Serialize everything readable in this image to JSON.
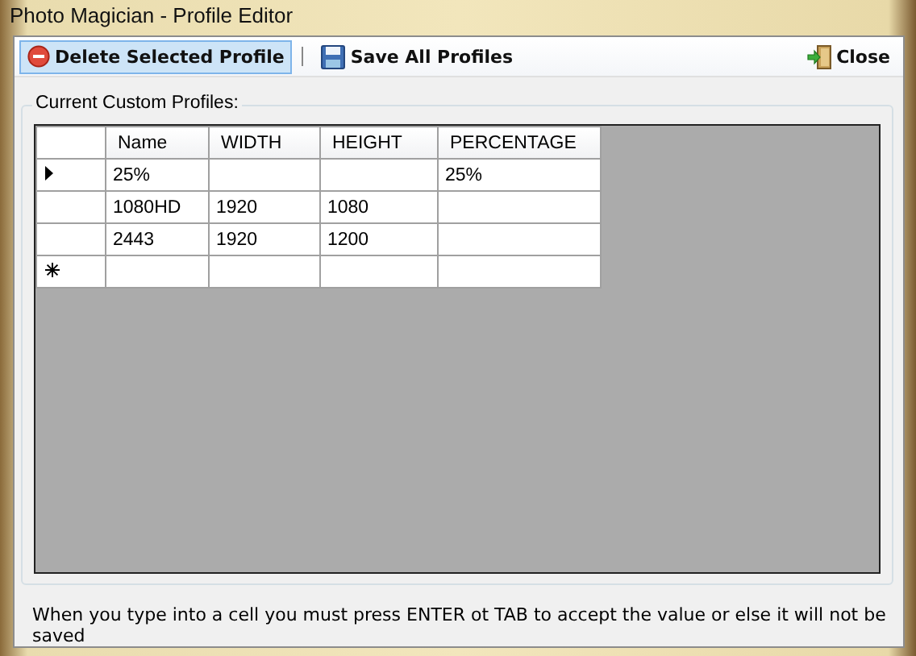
{
  "window": {
    "title": "Photo Magician - Profile Editor"
  },
  "toolbar": {
    "buttons": [
      {
        "label": "Delete Selected Profile",
        "kind": "delete",
        "selected": true
      },
      {
        "label": "Save All Profiles",
        "kind": "save",
        "selected": false
      }
    ],
    "close": {
      "label": "Close"
    }
  },
  "group": {
    "title": "Current Custom Profiles:"
  },
  "table": {
    "columns": [
      "Name",
      "WIDTH",
      "HEIGHT",
      "PERCENTAGE"
    ],
    "rows": [
      {
        "kind": "current",
        "cells": [
          "25%",
          "",
          "",
          "25%"
        ]
      },
      {
        "kind": "normal",
        "cells": [
          "1080HD",
          "1920",
          "1080",
          ""
        ]
      },
      {
        "kind": "normal",
        "cells": [
          "2443",
          "1920",
          "1200",
          ""
        ]
      },
      {
        "kind": "new",
        "cells": [
          "",
          "",
          "",
          ""
        ]
      }
    ]
  },
  "status_text": "When you type into a cell you must press ENTER ot TAB to accept the value or else it will not be saved"
}
